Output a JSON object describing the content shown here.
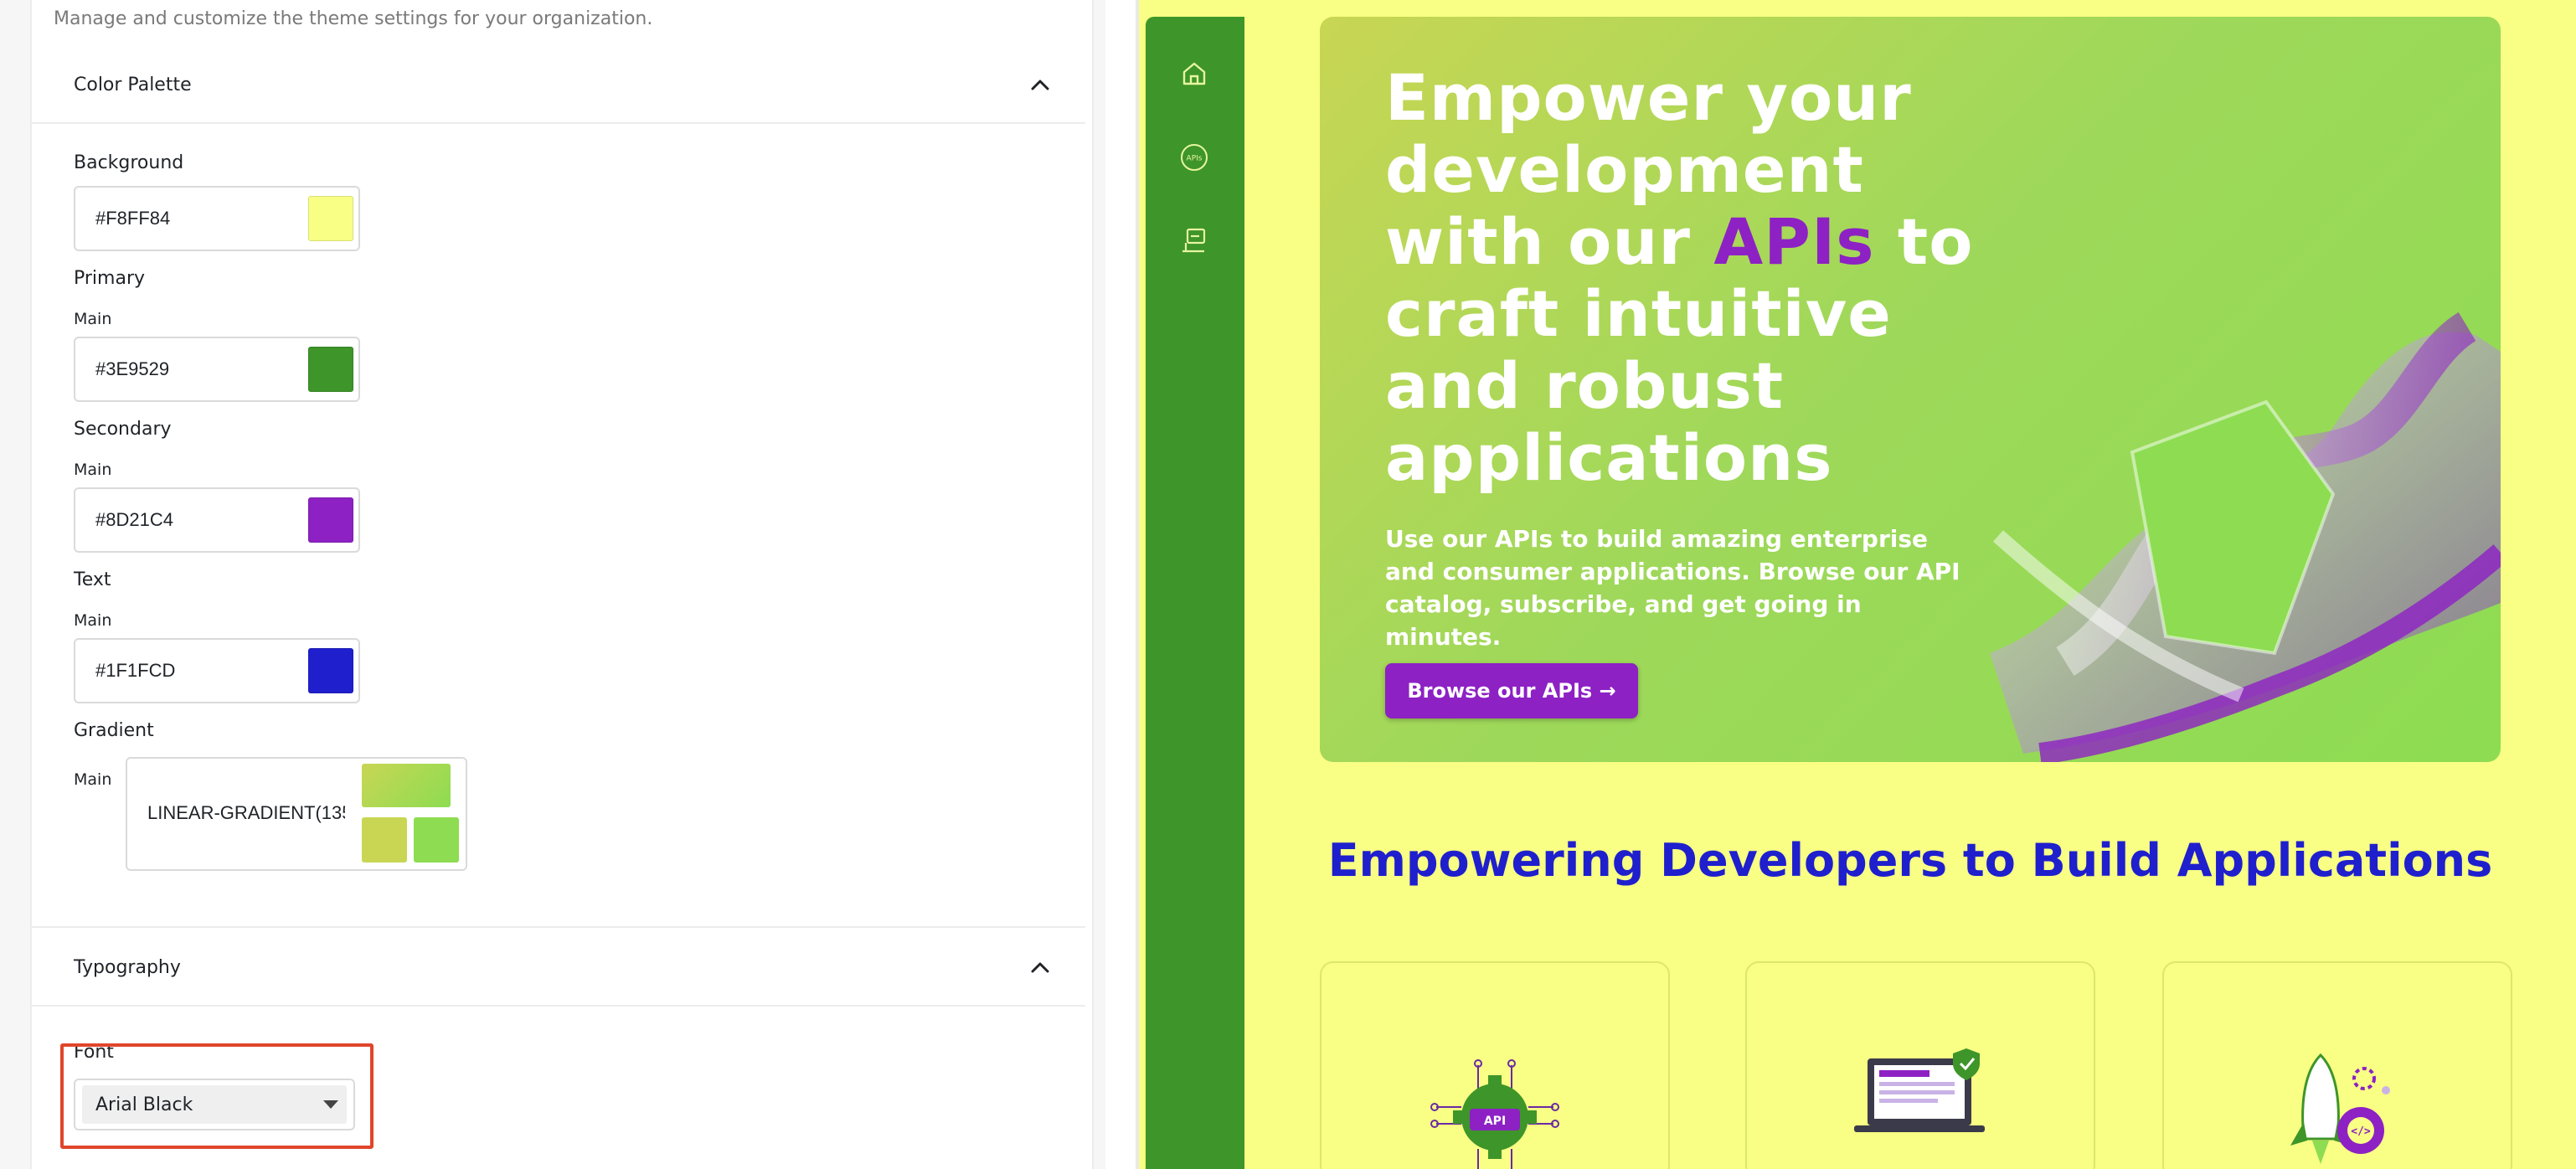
{
  "settings": {
    "subtitle": "Manage and customize the theme settings for your organization.",
    "color_palette": {
      "title": "Color Palette",
      "background": {
        "label": "Background",
        "value": "#F8FF84",
        "color": "#F8FF84"
      },
      "primary": {
        "label": "Primary",
        "sub_label": "Main",
        "value": "#3E9529",
        "color": "#3E9529"
      },
      "secondary": {
        "label": "Secondary",
        "sub_label": "Main",
        "value": "#8D21C4",
        "color": "#8D21C4"
      },
      "text": {
        "label": "Text",
        "sub_label": "Main",
        "value": "#1F1FCD",
        "color": "#1F1FCD"
      },
      "gradient": {
        "label": "Gradient",
        "sub_label": "Main",
        "value": "LINEAR-GRADIENT(135",
        "colors": [
          "#C8D654",
          "#9FD85A",
          "#8DDC52"
        ]
      }
    },
    "typography": {
      "title": "Typography",
      "font_label": "Font",
      "font_value": "Arial Black"
    }
  },
  "preview": {
    "nav_icons": [
      "home-icon",
      "apis-icon",
      "applications-icon"
    ],
    "nav_apis_text": "APIs",
    "hero": {
      "title_before": "Empower your development with our ",
      "title_accent": "APIs",
      "title_after": " to craft intuitive and robust applications",
      "description": "Use our APIs to build amazing enterprise and consumer applications. Browse our API catalog, subscribe, and get going in minutes.",
      "button_label": "Browse our APIs →"
    },
    "section_heading": "Empowering Developers to Build Applications",
    "feature_cards": [
      {
        "icon": "api-gear-icon",
        "badge": "API"
      },
      {
        "icon": "laptop-shield-icon"
      },
      {
        "icon": "rocket-gear-icon",
        "badge": "</>"
      }
    ]
  }
}
